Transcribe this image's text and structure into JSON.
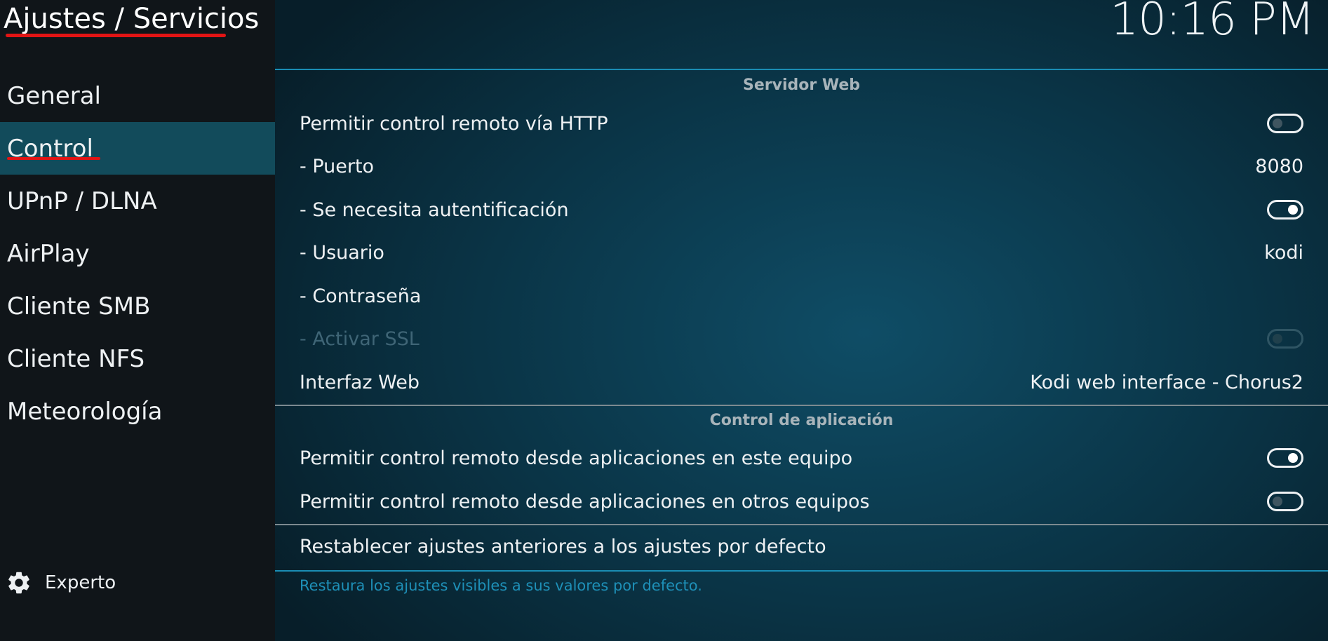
{
  "header": {
    "title": "Ajustes / Servicios",
    "clock": "10:16 PM"
  },
  "sidebar": {
    "items": [
      {
        "label": "General",
        "active": false
      },
      {
        "label": "Control",
        "active": true
      },
      {
        "label": "UPnP / DLNA",
        "active": false
      },
      {
        "label": "AirPlay",
        "active": false
      },
      {
        "label": "Cliente SMB",
        "active": false
      },
      {
        "label": "Cliente NFS",
        "active": false
      },
      {
        "label": "Meteorología",
        "active": false
      }
    ],
    "level_icon": "gear-icon",
    "level_label": "Experto"
  },
  "sections": {
    "web_server": {
      "title": "Servidor Web",
      "allow_http": {
        "label": "Permitir control remoto vía HTTP",
        "enabled": false
      },
      "port": {
        "label": "- Puerto",
        "value": "8080"
      },
      "auth": {
        "label": "- Se necesita autentificación",
        "enabled": true
      },
      "user": {
        "label": "- Usuario",
        "value": "kodi"
      },
      "password": {
        "label": "- Contraseña",
        "value": ""
      },
      "ssl": {
        "label": "- Activar SSL",
        "enabled": false,
        "disabled": true
      },
      "web_interface": {
        "label": "Interfaz Web",
        "value": "Kodi web interface - Chorus2"
      }
    },
    "app_control": {
      "title": "Control de aplicación",
      "local_apps": {
        "label": "Permitir control remoto desde aplicaciones en este equipo",
        "enabled": true
      },
      "remote_apps": {
        "label": "Permitir control remoto desde aplicaciones en otros equipos",
        "enabled": false
      }
    },
    "reset": {
      "label": "Restablecer ajustes anteriores a los ajustes por defecto"
    }
  },
  "hint": "Restaura los ajustes visibles a sus valores por defecto.",
  "colors": {
    "accent": "#1a8db4",
    "selected_bg": "#124b5b",
    "annotation_red": "#e21414"
  }
}
